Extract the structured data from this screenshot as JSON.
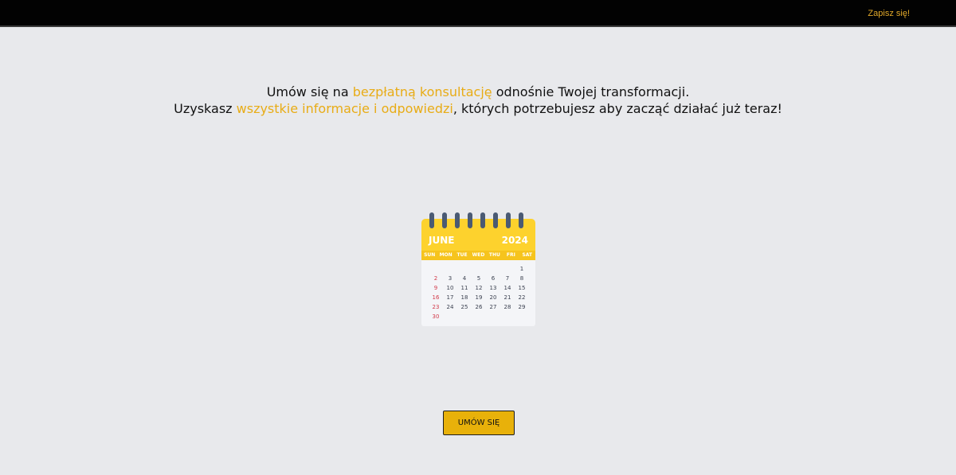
{
  "header": {
    "signup_label": "Zapisz się!"
  },
  "intro": {
    "line1": {
      "before": "Umów się na ",
      "highlight": "bezpłatną konsultację",
      "after": " odnośnie Twojej transformacji."
    },
    "line2": {
      "before": "Uzyskasz ",
      "highlight": "wszystkie informacje i odpowiedzi",
      "after": ", których potrzebujesz aby zacząć działać już teraz!"
    }
  },
  "calendar": {
    "icon": "calendar-icon",
    "month": "JUNE",
    "year": "2024",
    "weekdays": [
      "SUN",
      "MON",
      "TUE",
      "WED",
      "THU",
      "FRI",
      "SAT"
    ],
    "days": [
      "",
      "",
      "",
      "",
      "",
      "",
      "1",
      "2",
      "3",
      "4",
      "5",
      "6",
      "7",
      "8",
      "9",
      "10",
      "11",
      "12",
      "13",
      "14",
      "15",
      "16",
      "17",
      "18",
      "19",
      "20",
      "21",
      "22",
      "23",
      "24",
      "25",
      "26",
      "27",
      "28",
      "29",
      "30",
      "",
      "",
      "",
      "",
      "",
      ""
    ]
  },
  "cta": {
    "label": "UMÓW SIĘ"
  },
  "colors": {
    "topbar": "#020202",
    "background": "#e8e9ec",
    "accent": "#e8ac16",
    "button": "#e8b10a",
    "calendar_header": "#fdd22d",
    "sunday": "#d23a4a"
  }
}
